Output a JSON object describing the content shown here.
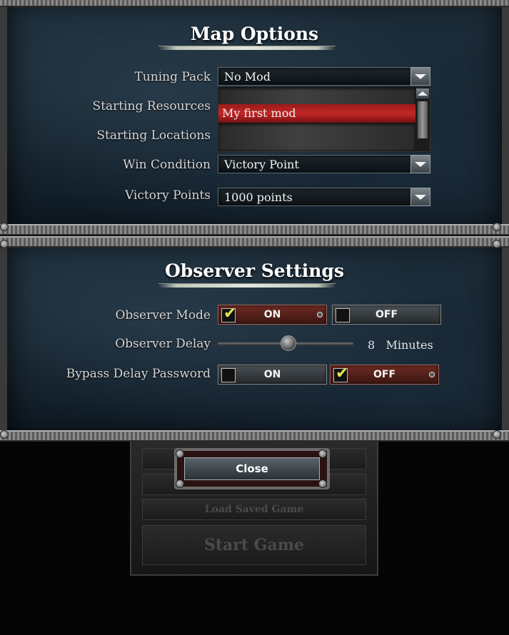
{
  "map_options": {
    "title": "Map Options",
    "tuning_pack": {
      "label": "Tuning Pack",
      "value": "No Mod"
    },
    "starting_resources": {
      "label": "Starting Resources"
    },
    "starting_locations": {
      "label": "Starting Locations"
    },
    "win_condition": {
      "label": "Win Condition",
      "value": "Victory Point"
    },
    "victory_points": {
      "label": "Victory Points",
      "value": "1000 points"
    },
    "dropdown_list": {
      "items": [
        "",
        "My first mod",
        ""
      ],
      "selected_index": 1
    }
  },
  "observer_settings": {
    "title": "Observer Settings",
    "observer_mode": {
      "label": "Observer Mode",
      "on_label": "ON",
      "off_label": "OFF",
      "selected": "ON"
    },
    "observer_delay": {
      "label": "Observer Delay",
      "value": "8",
      "unit": "Minutes"
    },
    "bypass_delay_password": {
      "label": "Bypass Delay Password",
      "on_label": "ON",
      "off_label": "OFF",
      "selected": "OFF"
    }
  },
  "buttons": {
    "close": "Close",
    "load_saved_game": "Load Saved Game",
    "start_game": "Start Game"
  },
  "colors": {
    "panel_bg": "#1a2a36",
    "selected_item": "#c12626",
    "toggle_on": "#6a2a22",
    "checkmark": "#e6e64a"
  }
}
